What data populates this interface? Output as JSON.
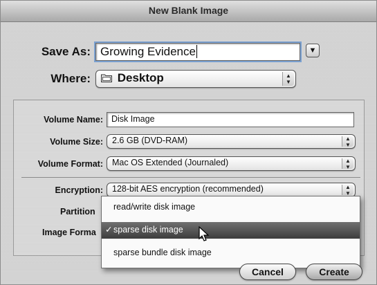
{
  "window": {
    "title": "New Blank Image"
  },
  "save_as": {
    "label": "Save As:",
    "value": "Growing Evidence"
  },
  "where": {
    "label": "Where:",
    "value": "Desktop",
    "icon": "folder-icon"
  },
  "volume_name": {
    "label": "Volume Name:",
    "value": "Disk Image"
  },
  "volume_size": {
    "label": "Volume Size:",
    "value": "2.6 GB (DVD-RAM)"
  },
  "volume_format": {
    "label": "Volume Format:",
    "value": "Mac OS Extended (Journaled)"
  },
  "encryption": {
    "label": "Encryption:",
    "value": "128-bit AES encryption (recommended)"
  },
  "partitions": {
    "label": "Partition"
  },
  "image_format": {
    "label": "Image Forma",
    "menu": [
      {
        "label": "read/write disk image",
        "selected": false
      },
      {
        "label": "sparse disk image",
        "selected": true,
        "check": "✓"
      },
      {
        "label": "sparse bundle disk image",
        "selected": false
      }
    ]
  },
  "buttons": {
    "cancel": "Cancel",
    "create": "Create"
  }
}
